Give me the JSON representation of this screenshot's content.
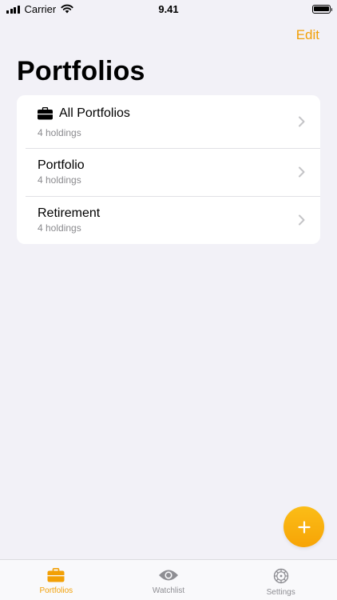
{
  "status_bar": {
    "carrier": "Carrier",
    "time": "9.41"
  },
  "nav": {
    "edit_label": "Edit",
    "title": "Portfolios"
  },
  "colors": {
    "accent": "#f2a006",
    "background": "#f2f1f7",
    "secondary_text": "#8a8a8e"
  },
  "portfolios": [
    {
      "name": "All Portfolios",
      "subtitle": "4 holdings",
      "icon": "briefcase-icon"
    },
    {
      "name": "Portfolio",
      "subtitle": "4 holdings"
    },
    {
      "name": "Retirement",
      "subtitle": "4 holdings"
    }
  ],
  "fab": {
    "icon": "plus-icon"
  },
  "tabs": [
    {
      "label": "Portfolios",
      "icon": "briefcase-icon",
      "active": true
    },
    {
      "label": "Watchlist",
      "icon": "eye-icon",
      "active": false
    },
    {
      "label": "Settings",
      "icon": "gear-icon",
      "active": false
    }
  ]
}
